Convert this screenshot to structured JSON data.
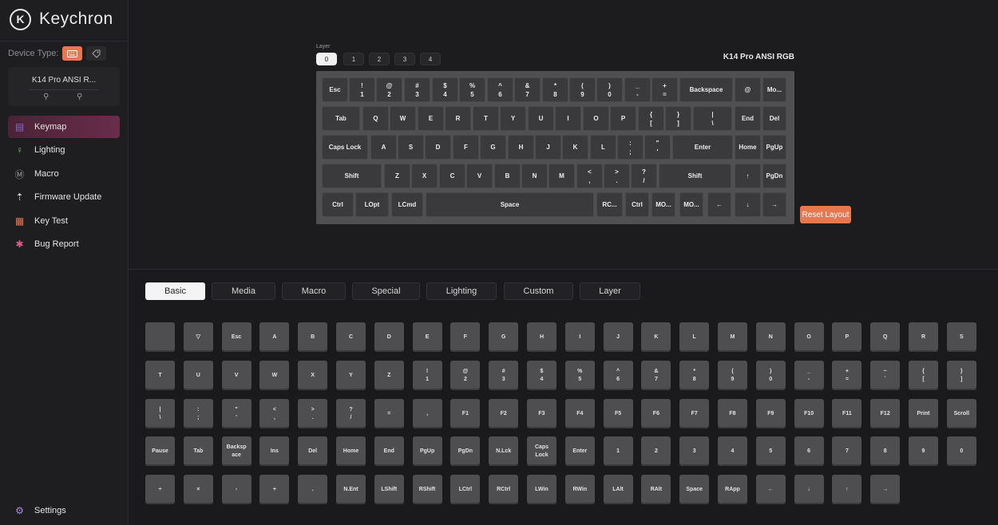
{
  "app": {
    "brand": "Keychron",
    "logo_glyph": "K"
  },
  "colors": {
    "accent": "#e8764e",
    "active_nav_gradient": [
      "#4a2436",
      "#6a2c4c"
    ],
    "background": "#1b1b1d"
  },
  "sidebar": {
    "device_type_label": "Device Type:",
    "device_type_icons": [
      "keyboard-icon",
      "tag-icon"
    ],
    "device_name": "K14 Pro ANSI R...",
    "device_links": [
      "link-icon",
      "link-icon"
    ],
    "nav": [
      {
        "label": "Keymap",
        "icon": "keyboard-icon",
        "glyph": "▤",
        "active": true
      },
      {
        "label": "Lighting",
        "icon": "bulb-icon",
        "glyph": "♀",
        "active": false
      },
      {
        "label": "Macro",
        "icon": "macro-icon",
        "glyph": "Ⓜ",
        "active": false
      },
      {
        "label": "Firmware Update",
        "icon": "upload-icon",
        "glyph": "⇡",
        "active": false
      },
      {
        "label": "Key Test",
        "icon": "keytest-icon",
        "glyph": "▦",
        "active": false
      },
      {
        "label": "Bug Report",
        "icon": "bug-icon",
        "glyph": "✱",
        "active": false
      }
    ],
    "settings_label": "Settings",
    "settings_glyph": "⚙"
  },
  "layers": {
    "label": "Layer",
    "items": [
      "0",
      "1",
      "2",
      "3",
      "4"
    ],
    "active": 0
  },
  "keyboard": {
    "model": "K14 Pro ANSI RGB",
    "rows": [
      [
        [
          "Esc"
        ],
        [
          "!",
          "1"
        ],
        [
          "@",
          "2"
        ],
        [
          "#",
          "3"
        ],
        [
          "$",
          "4"
        ],
        [
          "%",
          "5"
        ],
        [
          "^",
          "6"
        ],
        [
          "&",
          "7"
        ],
        [
          "*",
          "8"
        ],
        [
          "(",
          "9"
        ],
        [
          ")",
          "0"
        ],
        [
          "_",
          "-"
        ],
        [
          "+",
          "="
        ],
        [
          "Backspace"
        ],
        [
          "@"
        ],
        [
          "Mo..."
        ]
      ],
      [
        [
          "Tab"
        ],
        [
          "Q"
        ],
        [
          "W"
        ],
        [
          "E"
        ],
        [
          "R"
        ],
        [
          "T"
        ],
        [
          "Y"
        ],
        [
          "U"
        ],
        [
          "I"
        ],
        [
          "O"
        ],
        [
          "P"
        ],
        [
          "{",
          "["
        ],
        [
          "}",
          "]"
        ],
        [
          "|",
          "\\"
        ],
        [
          "End"
        ],
        [
          "Del"
        ]
      ],
      [
        [
          "Caps Lock"
        ],
        [
          "A"
        ],
        [
          "S"
        ],
        [
          "D"
        ],
        [
          "F"
        ],
        [
          "G"
        ],
        [
          "H"
        ],
        [
          "J"
        ],
        [
          "K"
        ],
        [
          "L"
        ],
        [
          ":",
          ";"
        ],
        [
          "\"",
          "'"
        ],
        [
          "Enter"
        ],
        [
          "Home"
        ],
        [
          "PgUp"
        ]
      ],
      [
        [
          "Shift"
        ],
        [
          "Z"
        ],
        [
          "X"
        ],
        [
          "C"
        ],
        [
          "V"
        ],
        [
          "B"
        ],
        [
          "N"
        ],
        [
          "M"
        ],
        [
          "<",
          ","
        ],
        [
          ">",
          "."
        ],
        [
          "?",
          "/"
        ],
        [
          "Shift"
        ],
        [
          "↑"
        ],
        [
          "PgDn"
        ]
      ],
      [
        [
          "Ctrl"
        ],
        [
          "LOpt"
        ],
        [
          "LCmd"
        ],
        [
          "Space"
        ],
        [
          "RC..."
        ],
        [
          "Ctrl"
        ],
        [
          "MO..."
        ],
        [
          "MO..."
        ],
        [
          "←"
        ],
        [
          "↓"
        ],
        [
          "→"
        ]
      ]
    ]
  },
  "reset_layout_label": "Reset Layout",
  "category_tabs": {
    "items": [
      "Basic",
      "Media",
      "Macro",
      "Special",
      "Lighting",
      "Custom",
      "Layer"
    ],
    "active": 0
  },
  "palette": {
    "rows": [
      [
        [
          ""
        ],
        [
          "▽"
        ],
        [
          "Esc"
        ],
        [
          "A"
        ],
        [
          "B"
        ],
        [
          "C"
        ],
        [
          "D"
        ],
        [
          "E"
        ],
        [
          "F"
        ],
        [
          "G"
        ],
        [
          "H"
        ],
        [
          "I"
        ],
        [
          "J"
        ],
        [
          "K"
        ],
        [
          "L"
        ],
        [
          "M"
        ],
        [
          "N"
        ],
        [
          "O"
        ],
        [
          "P"
        ],
        [
          "Q"
        ],
        [
          "R"
        ],
        [
          "S"
        ]
      ],
      [
        [
          "T"
        ],
        [
          "U"
        ],
        [
          "V"
        ],
        [
          "W"
        ],
        [
          "X"
        ],
        [
          "Y"
        ],
        [
          "Z"
        ],
        [
          "!",
          "1"
        ],
        [
          "@",
          "2"
        ],
        [
          "#",
          "3"
        ],
        [
          "$",
          "4"
        ],
        [
          "%",
          "5"
        ],
        [
          "^",
          "6"
        ],
        [
          "&",
          "7"
        ],
        [
          "*",
          "8"
        ],
        [
          "(",
          "9"
        ],
        [
          ")",
          "0"
        ],
        [
          "_",
          "-"
        ],
        [
          "+",
          "="
        ],
        [
          "~",
          "`"
        ],
        [
          "{",
          "["
        ],
        [
          "}",
          "]"
        ]
      ],
      [
        [
          "|",
          "\\"
        ],
        [
          ":",
          ";"
        ],
        [
          "\"",
          "'"
        ],
        [
          "<",
          ","
        ],
        [
          ">",
          "."
        ],
        [
          "?",
          "/"
        ],
        [
          "="
        ],
        [
          ","
        ],
        [
          "F1"
        ],
        [
          "F2"
        ],
        [
          "F3"
        ],
        [
          "F4"
        ],
        [
          "F5"
        ],
        [
          "F6"
        ],
        [
          "F7"
        ],
        [
          "F8"
        ],
        [
          "F9"
        ],
        [
          "F10"
        ],
        [
          "F11"
        ],
        [
          "F12"
        ],
        [
          "Print"
        ],
        [
          "Scroll"
        ]
      ],
      [
        [
          "Pause"
        ],
        [
          "Tab"
        ],
        [
          "Backsp",
          "ace"
        ],
        [
          "Ins"
        ],
        [
          "Del"
        ],
        [
          "Home"
        ],
        [
          "End"
        ],
        [
          "PgUp"
        ],
        [
          "PgDn"
        ],
        [
          "N.Lck"
        ],
        [
          "Caps",
          "Lock"
        ],
        [
          "Enter"
        ],
        [
          "1"
        ],
        [
          "2"
        ],
        [
          "3"
        ],
        [
          "4"
        ],
        [
          "5"
        ],
        [
          "6"
        ],
        [
          "7"
        ],
        [
          "8"
        ],
        [
          "9"
        ],
        [
          "0"
        ]
      ],
      [
        [
          "÷"
        ],
        [
          "×"
        ],
        [
          "-"
        ],
        [
          "+"
        ],
        [
          "."
        ],
        [
          "N.Ent"
        ],
        [
          "LShift"
        ],
        [
          "RShift"
        ],
        [
          "LCtrl"
        ],
        [
          "RCtrl"
        ],
        [
          "LWin"
        ],
        [
          "RWin"
        ],
        [
          "LAlt"
        ],
        [
          "RAlt"
        ],
        [
          "Space"
        ],
        [
          "RApp"
        ],
        [
          "←"
        ],
        [
          "↓"
        ],
        [
          "↑"
        ],
        [
          "→"
        ]
      ]
    ]
  }
}
